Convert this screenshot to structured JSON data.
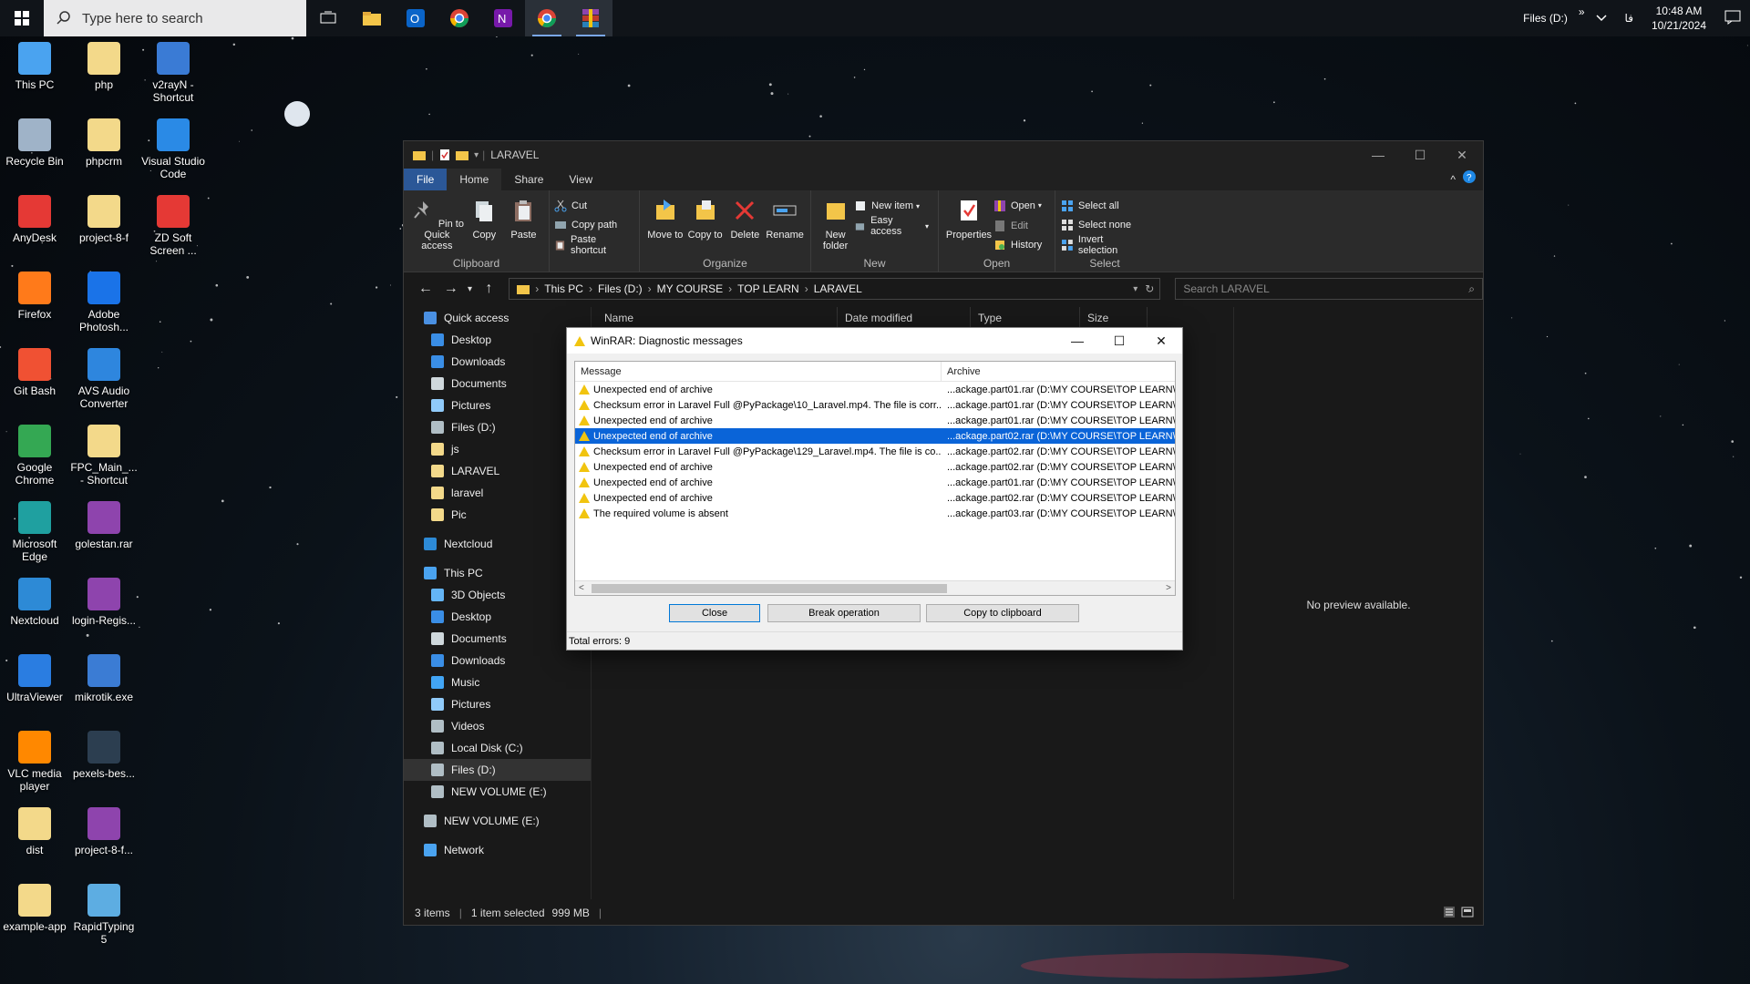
{
  "taskbar": {
    "search_placeholder": "Type here to search",
    "tray_drive": "Files (D:)",
    "tray_chevron": "»",
    "tray_lang": "فا",
    "time": "10:48 AM",
    "date": "10/21/2024"
  },
  "desktop_icons": [
    {
      "label": "This PC",
      "color": "#4aa3f0"
    },
    {
      "label": "php",
      "color": "#f3d98a"
    },
    {
      "label": "v2rayN - Shortcut",
      "color": "#3a7bd5"
    },
    {
      "label": "Recycle Bin",
      "color": "#9fb3c8"
    },
    {
      "label": "phpcrm",
      "color": "#f3d98a"
    },
    {
      "label": "Visual Studio Code",
      "color": "#2a8ae6"
    },
    {
      "label": "AnyDesk",
      "color": "#e53935"
    },
    {
      "label": "project-8-f",
      "color": "#f3d98a"
    },
    {
      "label": "ZD Soft Screen ...",
      "color": "#e53935"
    },
    {
      "label": "Firefox",
      "color": "#ff7a1a"
    },
    {
      "label": "Adobe Photosh...",
      "color": "#1a73e8"
    },
    {
      "label": "Git Bash",
      "color": "#f05133"
    },
    {
      "label": "AVS Audio Converter",
      "color": "#2e86de"
    },
    {
      "label": "Google Chrome",
      "color": "#34a853"
    },
    {
      "label": "FPC_Main_... - Shortcut",
      "color": "#f3d98a"
    },
    {
      "label": "Microsoft Edge",
      "color": "#1fa0a0"
    },
    {
      "label": "golestan.rar",
      "color": "#8e44ad"
    },
    {
      "label": "Nextcloud",
      "color": "#2d8ad6"
    },
    {
      "label": "login-Regis...",
      "color": "#8e44ad"
    },
    {
      "label": "UltraViewer",
      "color": "#2a7de1"
    },
    {
      "label": "mikrotik.exe",
      "color": "#3b7cd4"
    },
    {
      "label": "VLC media player",
      "color": "#ff8800"
    },
    {
      "label": "pexels-bes...",
      "color": "#2c3e50"
    },
    {
      "label": "dist",
      "color": "#f3d98a"
    },
    {
      "label": "project-8-f...",
      "color": "#8e44ad"
    },
    {
      "label": "example-app",
      "color": "#f3d98a"
    },
    {
      "label": "RapidTyping 5",
      "color": "#5dade2"
    }
  ],
  "explorer": {
    "title": "LARAVEL",
    "tabs": [
      "File",
      "Home",
      "Share",
      "View"
    ],
    "ribbon": {
      "clipboard": {
        "label": "Clipboard",
        "pin": "Pin to Quick access",
        "copy": "Copy",
        "paste": "Paste",
        "cut": "Cut",
        "copy_path": "Copy path",
        "paste_shortcut": "Paste shortcut"
      },
      "organize": {
        "label": "Organize",
        "move_to": "Move to",
        "copy_to": "Copy to",
        "delete": "Delete",
        "rename": "Rename"
      },
      "new": {
        "label": "New",
        "new_folder": "New folder",
        "new_item": "New item",
        "easy_access": "Easy access"
      },
      "open": {
        "label": "Open",
        "properties": "Properties",
        "open": "Open",
        "edit": "Edit",
        "history": "History"
      },
      "select": {
        "label": "Select",
        "select_all": "Select all",
        "select_none": "Select none",
        "invert": "Invert selection"
      }
    },
    "breadcrumb": [
      "This PC",
      "Files (D:)",
      "MY COURSE",
      "TOP LEARN",
      "LARAVEL"
    ],
    "search_placeholder": "Search LARAVEL",
    "columns": [
      "Name",
      "Date modified",
      "Type",
      "Size"
    ],
    "nav": [
      {
        "label": "Quick access",
        "indent": 0,
        "color": "#4a90e2"
      },
      {
        "label": "Desktop",
        "indent": 1,
        "color": "#3a8ee6"
      },
      {
        "label": "Downloads",
        "indent": 1,
        "color": "#3a8ee6"
      },
      {
        "label": "Documents",
        "indent": 1,
        "color": "#cfd8dc"
      },
      {
        "label": "Pictures",
        "indent": 1,
        "color": "#90caf9"
      },
      {
        "label": "Files (D:)",
        "indent": 1,
        "color": "#b0bec5"
      },
      {
        "label": "js",
        "indent": 1,
        "color": "#f3d98a"
      },
      {
        "label": "LARAVEL",
        "indent": 1,
        "color": "#f3d98a"
      },
      {
        "label": "laravel",
        "indent": 1,
        "color": "#f3d98a"
      },
      {
        "label": "Pic",
        "indent": 1,
        "color": "#f3d98a"
      },
      {
        "label": "",
        "indent": 0,
        "color": ""
      },
      {
        "label": "Nextcloud",
        "indent": 0,
        "color": "#2d8ad6"
      },
      {
        "label": "",
        "indent": 0,
        "color": ""
      },
      {
        "label": "This PC",
        "indent": 0,
        "color": "#4aa3f0"
      },
      {
        "label": "3D Objects",
        "indent": 1,
        "color": "#64b5f6"
      },
      {
        "label": "Desktop",
        "indent": 1,
        "color": "#3a8ee6"
      },
      {
        "label": "Documents",
        "indent": 1,
        "color": "#cfd8dc"
      },
      {
        "label": "Downloads",
        "indent": 1,
        "color": "#3a8ee6"
      },
      {
        "label": "Music",
        "indent": 1,
        "color": "#42a5f5"
      },
      {
        "label": "Pictures",
        "indent": 1,
        "color": "#90caf9"
      },
      {
        "label": "Videos",
        "indent": 1,
        "color": "#b0bec5"
      },
      {
        "label": "Local Disk (C:)",
        "indent": 1,
        "color": "#b0bec5"
      },
      {
        "label": "Files (D:)",
        "indent": 1,
        "color": "#b0bec5",
        "selected": true
      },
      {
        "label": "NEW VOLUME (E:)",
        "indent": 1,
        "color": "#b0bec5"
      },
      {
        "label": "",
        "indent": 0,
        "color": ""
      },
      {
        "label": "NEW VOLUME (E:)",
        "indent": 0,
        "color": "#b0bec5"
      },
      {
        "label": "",
        "indent": 0,
        "color": ""
      },
      {
        "label": "Network",
        "indent": 0,
        "color": "#4aa3f0"
      }
    ],
    "preview_text": "No preview available.",
    "status": {
      "items": "3 items",
      "selected": "1 item selected",
      "size": "999 MB"
    }
  },
  "dialog": {
    "title": "WinRAR: Diagnostic messages",
    "col_message": "Message",
    "col_archive": "Archive",
    "rows": [
      {
        "message": "Unexpected end of archive",
        "archive": "...ackage.part01.rar (D:\\MY COURSE\\TOP LEARN\\L"
      },
      {
        "message": "Checksum error in Laravel Full @PyPackage\\10_Laravel.mp4. The file is corr...",
        "archive": "...ackage.part01.rar (D:\\MY COURSE\\TOP LEARN\\L"
      },
      {
        "message": "Unexpected end of archive",
        "archive": "...ackage.part01.rar (D:\\MY COURSE\\TOP LEARN\\L"
      },
      {
        "message": "Unexpected end of archive",
        "archive": "...ackage.part02.rar (D:\\MY COURSE\\TOP LEARN\\L",
        "selected": true
      },
      {
        "message": "Checksum error in Laravel Full @PyPackage\\129_Laravel.mp4. The file is co...",
        "archive": "...ackage.part02.rar (D:\\MY COURSE\\TOP LEARN\\L"
      },
      {
        "message": "Unexpected end of archive",
        "archive": "...ackage.part02.rar (D:\\MY COURSE\\TOP LEARN\\L"
      },
      {
        "message": "Unexpected end of archive",
        "archive": "...ackage.part01.rar (D:\\MY COURSE\\TOP LEARN\\L"
      },
      {
        "message": "Unexpected end of archive",
        "archive": "...ackage.part02.rar (D:\\MY COURSE\\TOP LEARN\\L"
      },
      {
        "message": "The required volume is absent",
        "archive": "...ackage.part03.rar (D:\\MY COURSE\\TOP LEARN\\L"
      }
    ],
    "buttons": {
      "close": "Close",
      "break": "Break operation",
      "copy": "Copy to clipboard"
    },
    "status": "Total errors: 9"
  }
}
